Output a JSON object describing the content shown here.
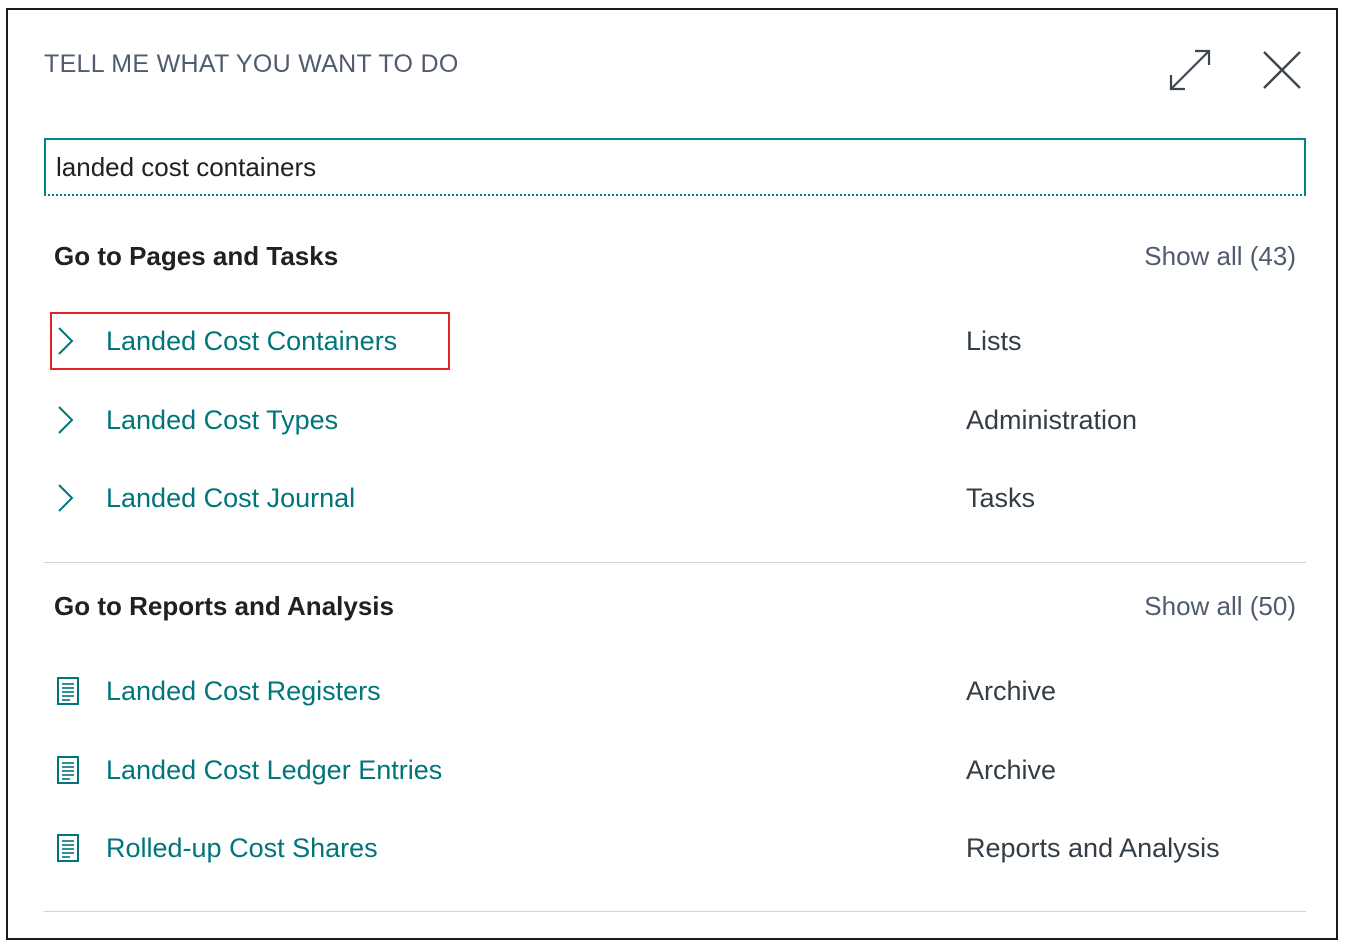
{
  "dialog": {
    "title": "TELL ME WHAT YOU WANT TO DO",
    "expand_icon": "expand-diagonal-icon",
    "close_icon": "close-x-icon"
  },
  "search": {
    "value": "landed cost containers"
  },
  "pages_section": {
    "title": "Go to Pages and Tasks",
    "show_all": "Show all (43)",
    "items": [
      {
        "label": "Landed Cost Containers",
        "category": "Lists",
        "icon": "chevron-right-icon",
        "highlighted": true
      },
      {
        "label": "Landed Cost Types",
        "category": "Administration",
        "icon": "chevron-right-icon"
      },
      {
        "label": "Landed Cost Journal",
        "category": "Tasks",
        "icon": "chevron-right-icon"
      }
    ]
  },
  "reports_section": {
    "title": "Go to Reports and Analysis",
    "show_all": "Show all (50)",
    "items": [
      {
        "label": "Landed Cost Registers",
        "category": "Archive",
        "icon": "report-document-icon"
      },
      {
        "label": "Landed Cost Ledger Entries",
        "category": "Archive",
        "icon": "report-document-icon"
      },
      {
        "label": "Rolled-up Cost Shares",
        "category": "Reports and Analysis",
        "icon": "report-document-icon"
      }
    ]
  },
  "colors": {
    "accent": "#008489",
    "link": "#00757a",
    "highlight": "#e32426"
  }
}
